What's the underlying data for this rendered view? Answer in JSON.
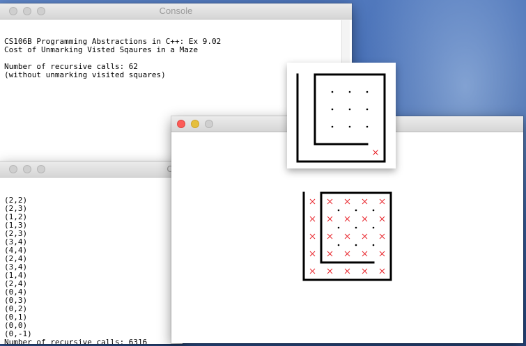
{
  "console1": {
    "title": "Console",
    "lines": [
      "CS106B Programming Abstractions in C++: Ex 9.02",
      "Cost of Unmarking Visted Sqaures in a Maze",
      "",
      "Number of recursive calls: 62",
      "(without unmarking visited squares)"
    ]
  },
  "console2": {
    "title": "Co",
    "lines": [
      "(2,2)",
      "(2,3)",
      "(1,2)",
      "(1,3)",
      "(2,3)",
      "(3,4)",
      "(4,4)",
      "(2,4)",
      "(3,4)",
      "(1,4)",
      "(2,4)",
      "(0,4)",
      "(0,3)",
      "(0,2)",
      "(0,1)",
      "(0,0)",
      "(0,-1)",
      "Number of recursive calls: 6316"
    ]
  },
  "colors": {
    "visited_mark": "#e8232a",
    "wall": "#000000",
    "close": "#fc5b57",
    "minimize": "#e5bf3c"
  },
  "icons": {
    "close": "close-icon",
    "minimize": "minimize-icon",
    "zoom": "zoom-icon"
  }
}
